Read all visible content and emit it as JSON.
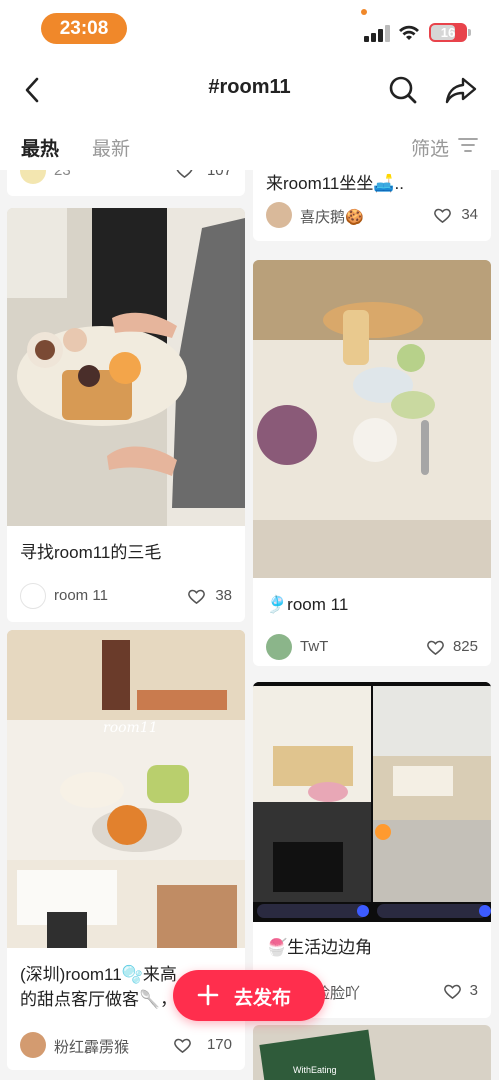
{
  "status_bar": {
    "time": "23:08",
    "battery": "16"
  },
  "header": {
    "title": "#room11"
  },
  "tabs": {
    "hot": "最热",
    "new": "最新",
    "filter": "筛选"
  },
  "feed": {
    "top_left_partial": {
      "likes": "107",
      "likes_prefix": "23"
    },
    "top_right_partial": {
      "title": "来room11坐坐🛋️..",
      "author": "喜庆鹅🍪",
      "likes": "34"
    },
    "cards": [
      {
        "title": "寻找room11的三毛",
        "author": "room 11",
        "likes": "38"
      },
      {
        "title": "🎐room 11",
        "author": "TwT",
        "likes": "825"
      },
      {
        "title_line1": "(深圳)room11🫧来高",
        "title_line2": "的甜点客厅做客🥄，",
        "image_text": "room11",
        "author": "粉红霹雳猴",
        "likes": "170"
      },
      {
        "title": "🍧生活边边角",
        "author": "脸脸脸吖",
        "likes": "3"
      }
    ],
    "bottom_right_partial": {
      "text": "WithEating"
    }
  },
  "fab": {
    "label": "去发布"
  },
  "colors": {
    "accent": "#ff2e4d",
    "time_pill": "#f0882a",
    "battery": "#e8434b"
  }
}
